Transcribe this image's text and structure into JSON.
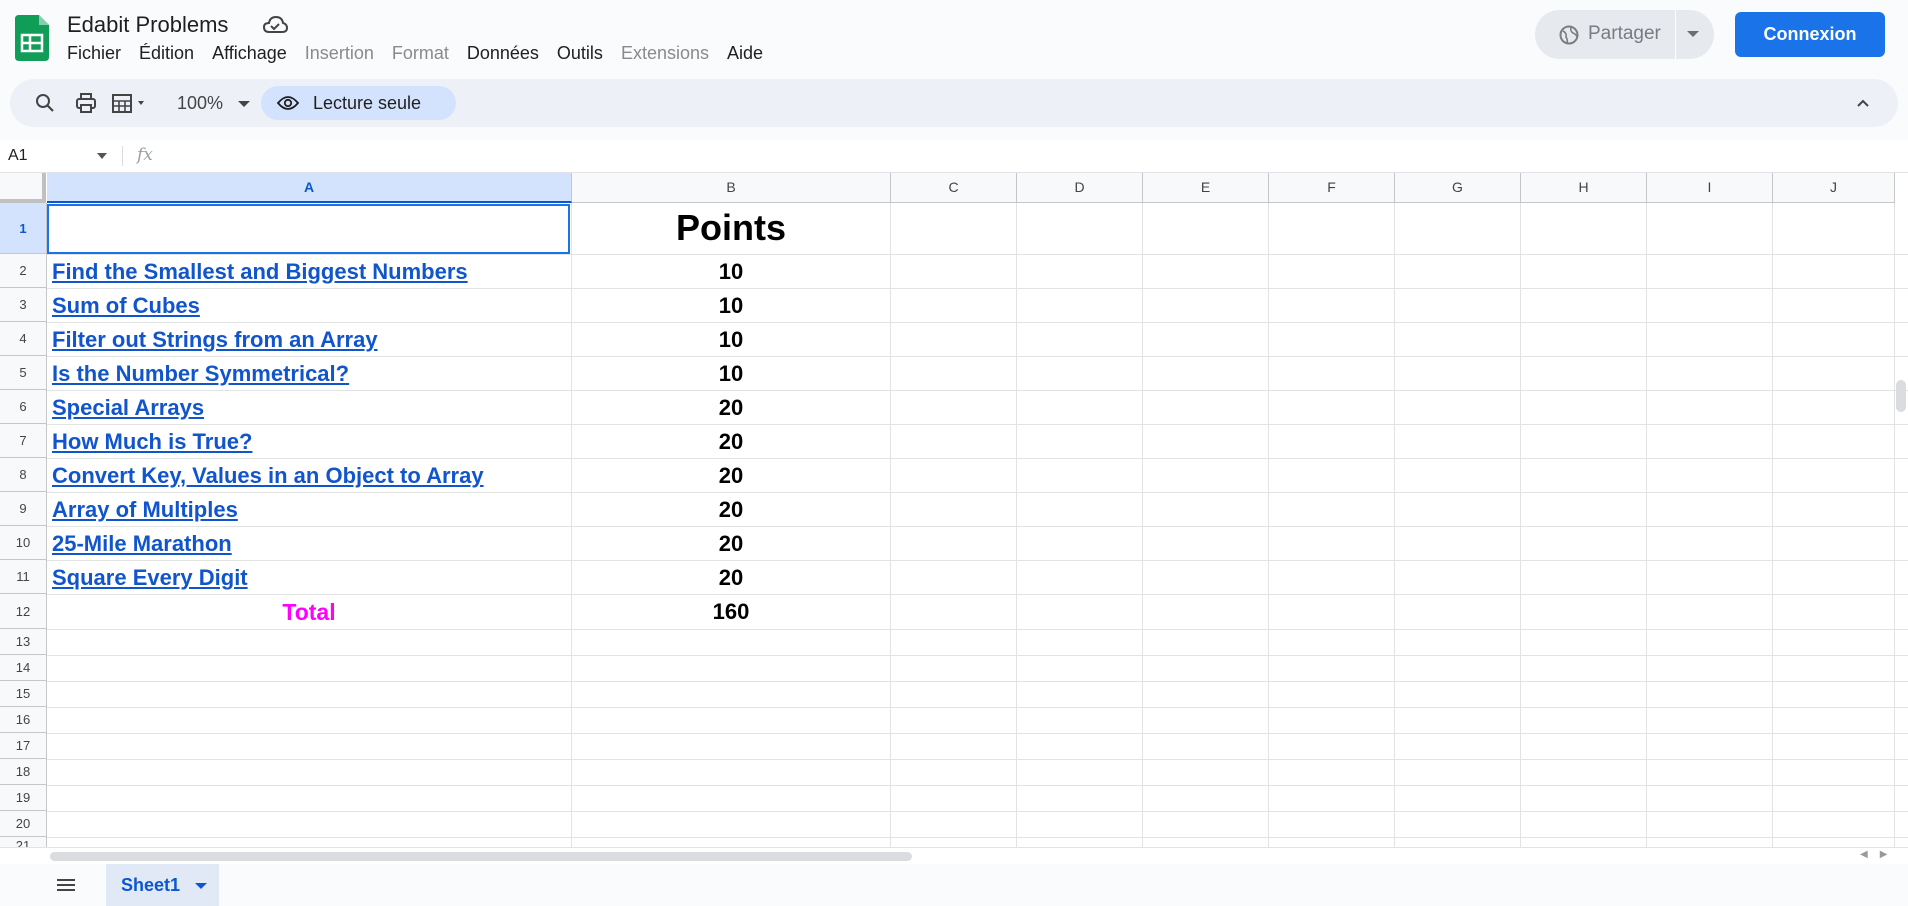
{
  "app": {
    "title": "Edabit Problems",
    "menu": [
      "Fichier",
      "Édition",
      "Affichage",
      "Insertion",
      "Format",
      "Données",
      "Outils",
      "Extensions",
      "Aide"
    ],
    "share_label": "Partager",
    "login_label": "Connexion",
    "accent_color": "#1a73e8"
  },
  "toolbar": {
    "zoom": "100%",
    "readonly_label": "Lecture seule",
    "icons": [
      "search-icon",
      "print-icon",
      "table-format-icon",
      "eye-icon",
      "chevron-up-icon"
    ]
  },
  "formula_bar": {
    "name_box": "A1",
    "fx": "fx",
    "value": ""
  },
  "sheet": {
    "columns": [
      "A",
      "B",
      "C",
      "D",
      "E",
      "F",
      "G",
      "H",
      "I",
      "J"
    ],
    "rows": [
      "1",
      "2",
      "3",
      "4",
      "5",
      "6",
      "7",
      "8",
      "9",
      "10",
      "11",
      "12",
      "13",
      "14",
      "15",
      "16",
      "17",
      "18",
      "19",
      "20",
      "21"
    ],
    "header_b": "Points",
    "problems": [
      {
        "name": "Find the Smallest and Biggest Numbers",
        "points": "10"
      },
      {
        "name": "Sum of Cubes",
        "points": "10"
      },
      {
        "name": "Filter out Strings from an Array",
        "points": "10"
      },
      {
        "name": "Is the Number Symmetrical?",
        "points": "10"
      },
      {
        "name": "Special Arrays",
        "points": "20"
      },
      {
        "name": "How Much is True?",
        "points": "20"
      },
      {
        "name": "Convert Key, Values in an Object to Array",
        "points": "20"
      },
      {
        "name": "Array of Multiples",
        "points": "20"
      },
      {
        "name": "25-Mile Marathon",
        "points": "20"
      },
      {
        "name": "Square Every Digit",
        "points": "20"
      }
    ],
    "total_label": "Total",
    "total_value": "160",
    "link_color": "#1155cc",
    "total_color": "#ff00ff"
  },
  "tabs": {
    "active": "Sheet1"
  }
}
